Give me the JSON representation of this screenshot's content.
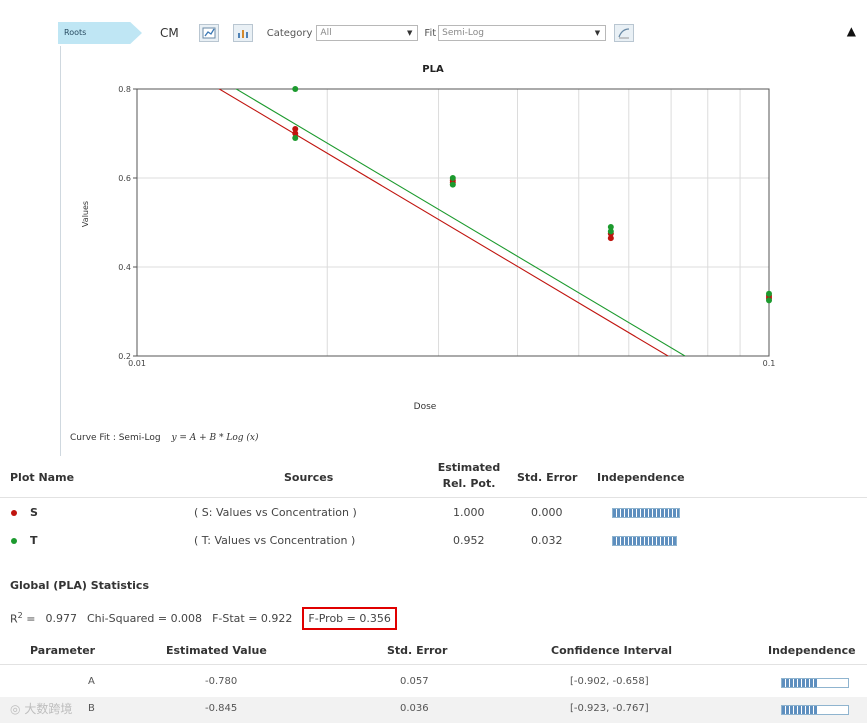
{
  "toolbar": {
    "plot_tab": "Roots",
    "cm_label": "CM",
    "category_label": "Category",
    "category_value": "All",
    "fit_label": "Fit",
    "fit_value": "Semi-Log",
    "collapse_glyph": "▲",
    "icons": [
      "scatter-chart-icon",
      "bar-chart-icon",
      "curve-fit-icon"
    ]
  },
  "chart_data": {
    "type": "scatter",
    "title": "PLA",
    "xlabel": "Dose",
    "ylabel": "Values",
    "x_scale": "log",
    "xlim": [
      0.01,
      0.1
    ],
    "ylim": [
      0.2,
      0.8
    ],
    "x_ticks": [
      "0.01",
      "0.1"
    ],
    "y_ticks": [
      "0.2",
      "0.4",
      "0.6",
      "0.8"
    ],
    "grid": true,
    "series": [
      {
        "name": "S",
        "color": "#c0140f",
        "points": [
          [
            0.0178,
            0.71
          ],
          [
            0.0178,
            0.7
          ],
          [
            0.0316,
            0.595
          ],
          [
            0.0316,
            0.59
          ],
          [
            0.0562,
            0.475
          ],
          [
            0.0562,
            0.465
          ],
          [
            0.1,
            0.335
          ],
          [
            0.1,
            0.33
          ]
        ],
        "fit": {
          "intercept": -0.78,
          "slope": -0.845
        }
      },
      {
        "name": "T",
        "color": "#1c9a2e",
        "points": [
          [
            0.0178,
            0.8
          ],
          [
            0.0178,
            0.69
          ],
          [
            0.0316,
            0.6
          ],
          [
            0.0316,
            0.585
          ],
          [
            0.0562,
            0.49
          ],
          [
            0.0562,
            0.48
          ],
          [
            0.1,
            0.34
          ],
          [
            0.1,
            0.325
          ]
        ],
        "fit": {
          "intercept": -0.7573,
          "slope": -0.845
        }
      }
    ]
  },
  "curve_fit": {
    "label": "Curve Fit : Semi-Log",
    "equation": "y = A + B * Log (x)"
  },
  "plot_table": {
    "headers": {
      "plot_name": "Plot Name",
      "sources": "Sources",
      "estimated_rel_pot_line1": "Estimated",
      "estimated_rel_pot_line2": "Rel. Pot.",
      "std_error": "Std. Error",
      "independence": "Independence"
    },
    "rows": [
      {
        "name": "S",
        "color": "#c0140f",
        "sources": "( S: Values vs Concentration )",
        "rel_pot": "1.000",
        "std_error": "0.000",
        "independence": 1.0
      },
      {
        "name": "T",
        "color": "#1c9a2e",
        "sources": "( T: Values vs Concentration )",
        "rel_pot": "0.952",
        "std_error": "0.032",
        "independence": 0.95
      }
    ]
  },
  "global_stats": {
    "title": "Global (PLA) Statistics",
    "r2_label": "R",
    "r2_sup": "2",
    "r2_eq": " =",
    "r2_value": "0.977",
    "chi_squared": "Chi-Squared = 0.008",
    "f_stat": "F-Stat = 0.922",
    "f_prob": "F-Prob = 0.356"
  },
  "param_table": {
    "headers": {
      "parameter": "Parameter",
      "estimated_value": "Estimated Value",
      "std_error": "Std. Error",
      "confidence_interval": "Confidence Interval",
      "independence": "Independence"
    },
    "rows": [
      {
        "parameter": "A",
        "estimated_value": "-0.780",
        "std_error": "0.057",
        "confidence_interval": "[-0.902, -0.658]",
        "independence": 0.55
      },
      {
        "parameter": "B",
        "estimated_value": "-0.845",
        "std_error": "0.036",
        "confidence_interval": "[-0.923, -0.767]",
        "independence": 0.55
      }
    ]
  },
  "watermark": "大数跨境"
}
